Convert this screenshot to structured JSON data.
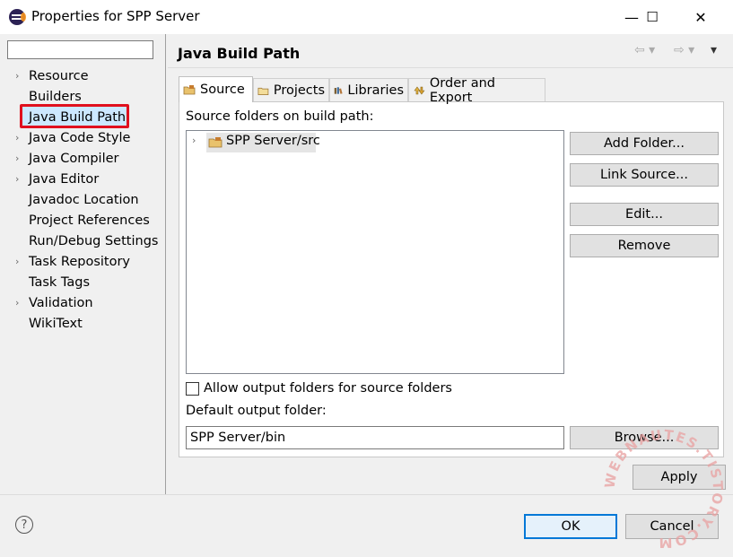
{
  "window": {
    "title": "Properties for SPP Server",
    "minimize": "—",
    "maximize": "☐",
    "close": "✕"
  },
  "nav": {
    "items": [
      {
        "label": "Resource",
        "expandable": true
      },
      {
        "label": "Builders",
        "expandable": false
      },
      {
        "label": "Java Build Path",
        "expandable": false,
        "selected": true
      },
      {
        "label": "Java Code Style",
        "expandable": true
      },
      {
        "label": "Java Compiler",
        "expandable": true
      },
      {
        "label": "Java Editor",
        "expandable": true
      },
      {
        "label": "Javadoc Location",
        "expandable": false
      },
      {
        "label": "Project References",
        "expandable": false
      },
      {
        "label": "Run/Debug Settings",
        "expandable": false
      },
      {
        "label": "Task Repository",
        "expandable": true
      },
      {
        "label": "Task Tags",
        "expandable": false
      },
      {
        "label": "Validation",
        "expandable": true
      },
      {
        "label": "WikiText",
        "expandable": false
      }
    ]
  },
  "page": {
    "title": "Java Build Path",
    "tabs": [
      {
        "label": "Source",
        "active": true
      },
      {
        "label": "Projects"
      },
      {
        "label": "Libraries"
      },
      {
        "label": "Order and Export"
      }
    ],
    "source_label": "Source folders on build path:",
    "tree_item": "SPP Server/src",
    "buttons": {
      "add_folder": "Add Folder...",
      "link_source": "Link Source...",
      "edit": "Edit...",
      "remove": "Remove",
      "browse": "Browse..."
    },
    "allow_output_label": "Allow output folders for source folders",
    "allow_output_checked": false,
    "default_output_label": "Default output folder:",
    "default_output_value": "SPP Server/bin"
  },
  "footer": {
    "apply": "Apply",
    "ok": "OK",
    "cancel": "Cancel"
  },
  "watermark": "WEBNAUTES.TISTORY.COM",
  "colors": {
    "selection": "#cce8ff",
    "highlight": "#e0101e",
    "focus": "#0078d7",
    "watermark": "#e8a0a0"
  }
}
